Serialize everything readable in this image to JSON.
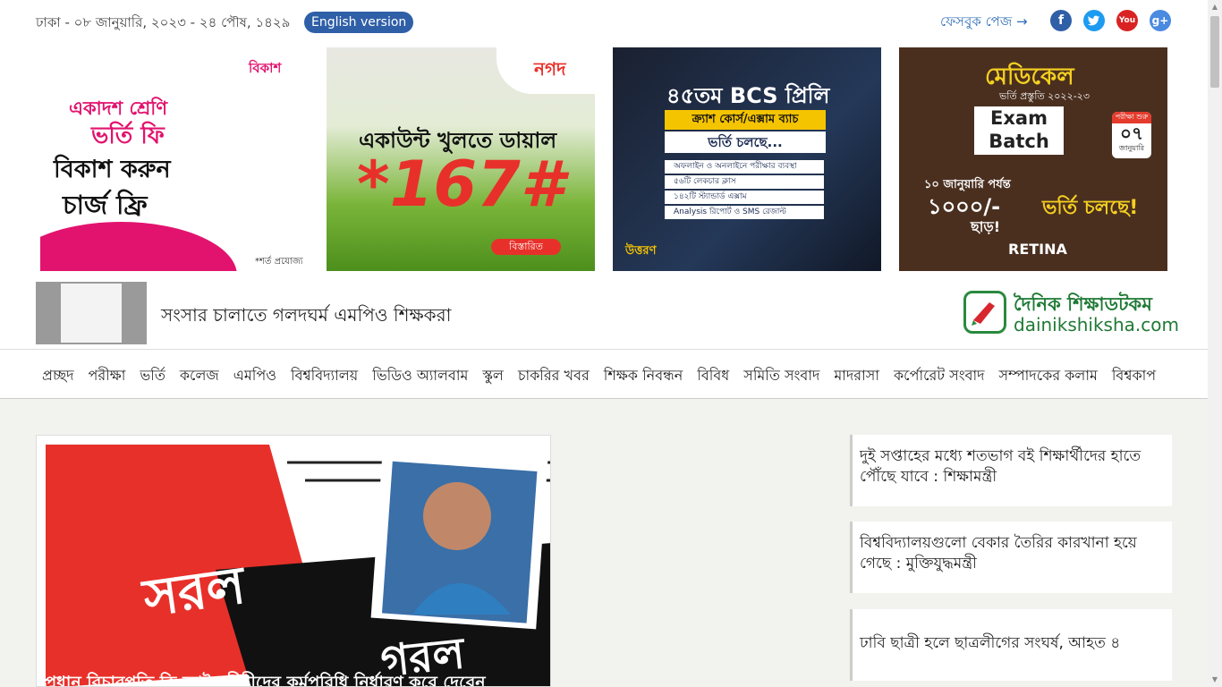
{
  "topbar": {
    "date": "ঢাকা - ০৮ জানুয়ারি, ২০২৩ - ২৪ পৌষ, ১৪২৯",
    "english_version": "English version",
    "facebook_page": "ফেসবুক পেজ →"
  },
  "social_icons": [
    "facebook-icon",
    "twitter-icon",
    "youtube-icon",
    "google-plus-icon"
  ],
  "ads": {
    "bkash": {
      "brand": "বিকাশ",
      "line1": "একাদশ শ্রেণি",
      "line2": "ভর্তি ফি",
      "line3": "বিকাশ করুন",
      "line4": "চার্জ ফ্রি",
      "note": "*শর্ত প্রযোজ্য"
    },
    "nagad": {
      "brand": "নগদ",
      "line1": "একাউন্ট খুলতে ডায়াল",
      "code": "*167#",
      "button": "বিস্তারিত"
    },
    "bcs": {
      "title": "৪৫তম BCS প্রিলি",
      "subtitle": "ক্র্যাশ কোর্স/এক্সাম ব্যাচ",
      "status": "ভর্তি চলছে...",
      "points": [
        "অফলাইন ও অনলাইনে পরীক্ষার ব্যবস্থা",
        "৫৬টি লেকচার ক্লাস",
        "১৪২টি স্ট্যান্ডার্ড এক্সাম",
        "Analysis রিপোর্ট ও SMS রেজাল্ট"
      ],
      "brand": "উত্তরণ"
    },
    "retina": {
      "title": "মেডিকেল",
      "subtitle": "ভর্তি প্রস্তুতি ২০২২-২৩",
      "batch": "Exam Batch",
      "date_label": "পরীক্ষা শুরু",
      "date_day": "০৭",
      "date_month": "জানুয়ারি",
      "offer_line": "১০ জানুয়ারি পর্যন্ত",
      "discount": "১০০০/-",
      "discount_label": "ছাড়!",
      "status": "ভর্তি চলছে!",
      "brand": "RETINA"
    }
  },
  "headline": "সংসার চালাতে গলদঘর্ম এমপিও শিক্ষকরা",
  "logo": {
    "line1": "দৈনিক শিক্ষাডটকম",
    "line2": "dainikshiksha.com"
  },
  "nav": [
    "প্রচ্ছদ",
    "পরীক্ষা",
    "ভর্তি",
    "কলেজ",
    "এমপিও",
    "বিশ্ববিদ্যালয়",
    "ভিডিও অ্যালবাম",
    "স্কুল",
    "চাকরির খবর",
    "শিক্ষক নিবন্ধন",
    "বিবিধ",
    "সমিতি সংবাদ",
    "মাদরাসা",
    "কর্পোরেট সংবাদ",
    "সম্পাদকের কলাম",
    "বিশ্বকাপ"
  ],
  "lead_story": {
    "title": "প্রধান বিচারপতি কি আইনজীবীদের কর্মপরিধি নির্ধারণ করে দেবেন",
    "art_text1": "সরল",
    "art_text2": "গরল"
  },
  "side_news": [
    "দুই সপ্তাহের মধ্যে শতভাগ বই শিক্ষার্থীদের হাতে পৌঁছে যাবে : শিক্ষামন্ত্রী",
    "বিশ্ববিদ্যালয়গুলো বেকার তৈরির কারখানা হয়ে গেছে : মুক্তিযুদ্ধমন্ত্রী",
    "ঢাবি ছাত্রী হলে ছাত্রলীগের সংঘর্ষ, আহত ৪"
  ],
  "colors": {
    "accent_blue": "#2f5fa7",
    "logo_green": "#1f7a35",
    "bkash_pink": "#e2136e",
    "nagad_red": "#e8302a"
  }
}
